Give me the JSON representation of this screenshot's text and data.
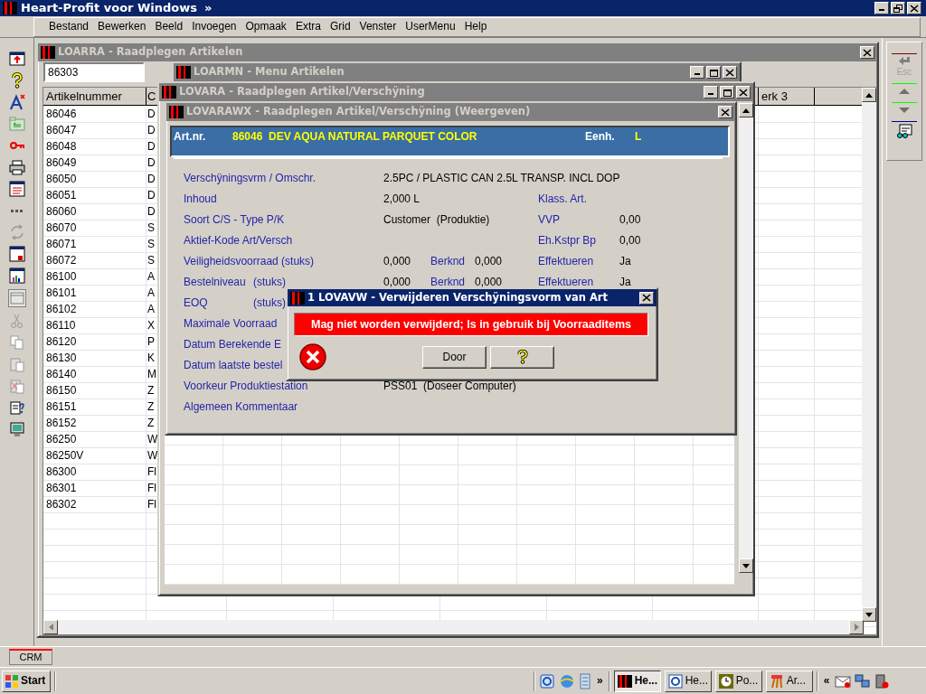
{
  "app": {
    "title": "Heart-Profit voor Windows",
    "chevron": "»"
  },
  "menu": [
    "Bestand",
    "Bewerken",
    "Beeld",
    "Invoegen",
    "Opmaak",
    "Extra",
    "Grid",
    "Venster",
    "UserMenu",
    "Help"
  ],
  "toolbar_right": {
    "esc_label": "Esc"
  },
  "articles_window": {
    "title": "LOARRA - Raadplegen Artikelen",
    "search_value": "86303",
    "columns": [
      "Artikelnummer",
      "C",
      "erk 3"
    ],
    "rows": [
      {
        "artikelnummer": "86046",
        "column_2": "D"
      },
      {
        "artikelnummer": "86047",
        "column_2": "D"
      },
      {
        "artikelnummer": "86048",
        "column_2": "D"
      },
      {
        "artikelnummer": "86049",
        "column_2": "D"
      },
      {
        "artikelnummer": "86050",
        "column_2": "D"
      },
      {
        "artikelnummer": "86051",
        "column_2": "D"
      },
      {
        "artikelnummer": "86060",
        "column_2": "D"
      },
      {
        "artikelnummer": "86070",
        "column_2": "S"
      },
      {
        "artikelnummer": "86071",
        "column_2": "S"
      },
      {
        "artikelnummer": "86072",
        "column_2": "S"
      },
      {
        "artikelnummer": "86100",
        "column_2": "A"
      },
      {
        "artikelnummer": "86101",
        "column_2": "A"
      },
      {
        "artikelnummer": "86102",
        "column_2": "A"
      },
      {
        "artikelnummer": "86110",
        "column_2": "X"
      },
      {
        "artikelnummer": "86120",
        "column_2": "P"
      },
      {
        "artikelnummer": "86130",
        "column_2": "K"
      },
      {
        "artikelnummer": "86140",
        "column_2": "M"
      },
      {
        "artikelnummer": "86150",
        "column_2": "Z"
      },
      {
        "artikelnummer": "86151",
        "column_2": "Z"
      },
      {
        "artikelnummer": "86152",
        "column_2": "Z"
      },
      {
        "artikelnummer": "86250",
        "column_2": "W"
      },
      {
        "artikelnummer": "86250V",
        "column_2": "W"
      },
      {
        "artikelnummer": "86300",
        "column_2": "Fl"
      },
      {
        "artikelnummer": "86301",
        "column_2": "Fl"
      },
      {
        "artikelnummer": "86302",
        "column_2": "Fl"
      }
    ]
  },
  "menu_window": {
    "title": "LOARMN - Menu Artikelen"
  },
  "variant_window": {
    "title": "LOVARA - Raadplegen Artikel/Verschÿning"
  },
  "detail_window": {
    "title": "LOVARAWX - Raadplegen Artikel/Verschÿning (Weergeven)",
    "header": {
      "art_label": "Art.nr.",
      "art_value": "86046  DEV AQUA NATURAL PARQUET COLOR",
      "unit_label": "Eenh.",
      "unit_value": "L"
    },
    "fields": [
      {
        "label": "Verschÿningsvrm / Omschr.",
        "value": "2.5PC / PLASTIC CAN 2.5L TRANSP. INCL DOP"
      },
      {
        "label": "Inhoud",
        "value": "2,000 L",
        "right_label": "Klass. Art."
      },
      {
        "label": "Soort C/S - Type P/K",
        "value": "Customer  (Produktie)",
        "right_label": "VVP",
        "right_value": "0,00"
      },
      {
        "label": "Aktief-Kode Art/Versch",
        "right_label": "Eh.Kstpr Bp",
        "right_value": "0,00"
      },
      {
        "label": "Veiligheidsvoorraad (stuks)",
        "value": "0,000",
        "mid_label": "Berknd",
        "mid_value": "0,000",
        "right_label": "Effektueren",
        "right_value": "Ja"
      },
      {
        "label": "Bestelniveau",
        "unit": "(stuks)",
        "value": "0,000",
        "mid_label": "Berknd",
        "mid_value": "0,000",
        "right_label": "Effektueren",
        "right_value": "Ja"
      },
      {
        "label": "EOQ",
        "unit": "(stuks)"
      },
      {
        "label": "Maximale Voorraad"
      },
      {
        "label": "Datum Berekende E"
      },
      {
        "label": "Datum laatste bestel"
      },
      {
        "label": "Voorkeur Produktiestation",
        "value": "PSS01  (Doseer Computer)"
      },
      {
        "label": "Algemeen Kommentaar"
      }
    ]
  },
  "dialog": {
    "title": "1 LOVAVW - Verwijderen Verschÿningsvorm van Art",
    "message": "Mag niet worden verwijderd; Is in gebruik bij Voorraaditems",
    "buttons": [
      {
        "kind": "text",
        "label": "Door"
      },
      {
        "kind": "help"
      }
    ]
  },
  "bottom_tabs": [
    {
      "label": "CRM"
    }
  ],
  "taskbar": {
    "start": "Start",
    "quick_more": "»",
    "tray_more": "«",
    "tasks": [
      {
        "label": "He...",
        "selected": true
      },
      {
        "label": "He...",
        "selected": false
      },
      {
        "label": "Po...",
        "selected": false
      },
      {
        "label": "Ar...",
        "selected": false
      }
    ]
  }
}
